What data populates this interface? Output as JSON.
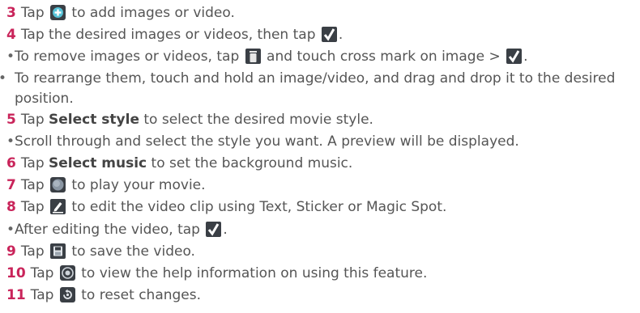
{
  "steps": [
    {
      "num": "3",
      "parts": [
        "Tap ",
        " to add images or video."
      ]
    },
    {
      "num": "4",
      "parts": [
        "Tap the desired images or videos, then tap ",
        "."
      ]
    },
    {
      "bullet": "•",
      "parts": [
        "To remove images or videos, tap ",
        " and touch cross mark on image > ",
        "."
      ]
    },
    {
      "bullet": "•",
      "text": "To rearrange them, touch and hold an image/video, and drag and drop it to the desired position."
    },
    {
      "num": "5",
      "pre": "Tap ",
      "bold": "Select style",
      "post": " to select the desired movie style."
    },
    {
      "bullet": "•",
      "text": "Scroll through and select the style you want. A preview will be displayed."
    },
    {
      "num": "6",
      "pre": "Tap ",
      "bold": "Select music",
      "post": " to set the background music."
    },
    {
      "num": "7",
      "parts": [
        "Tap ",
        " to play your movie."
      ]
    },
    {
      "num": "8",
      "parts": [
        "Tap ",
        " to edit the video clip using Text, Sticker or Magic Spot."
      ]
    },
    {
      "bullet": "•",
      "parts": [
        "After editing the video, tap ",
        "."
      ]
    },
    {
      "num": "9",
      "parts": [
        "Tap ",
        " to save the video."
      ]
    },
    {
      "num": "10",
      "parts": [
        "Tap ",
        " to view the help information on using this feature."
      ]
    },
    {
      "num": "11",
      "parts": [
        "Tap ",
        " to reset changes."
      ]
    }
  ],
  "colors": {
    "step_number": "#c9245a",
    "icon_bg": "#3a3f45",
    "check": "#7fd13b"
  },
  "icons": [
    "add-icon",
    "checkmark-icon",
    "trash-icon",
    "play-icon",
    "edit-icon",
    "save-icon",
    "help-icon",
    "reset-icon"
  ]
}
